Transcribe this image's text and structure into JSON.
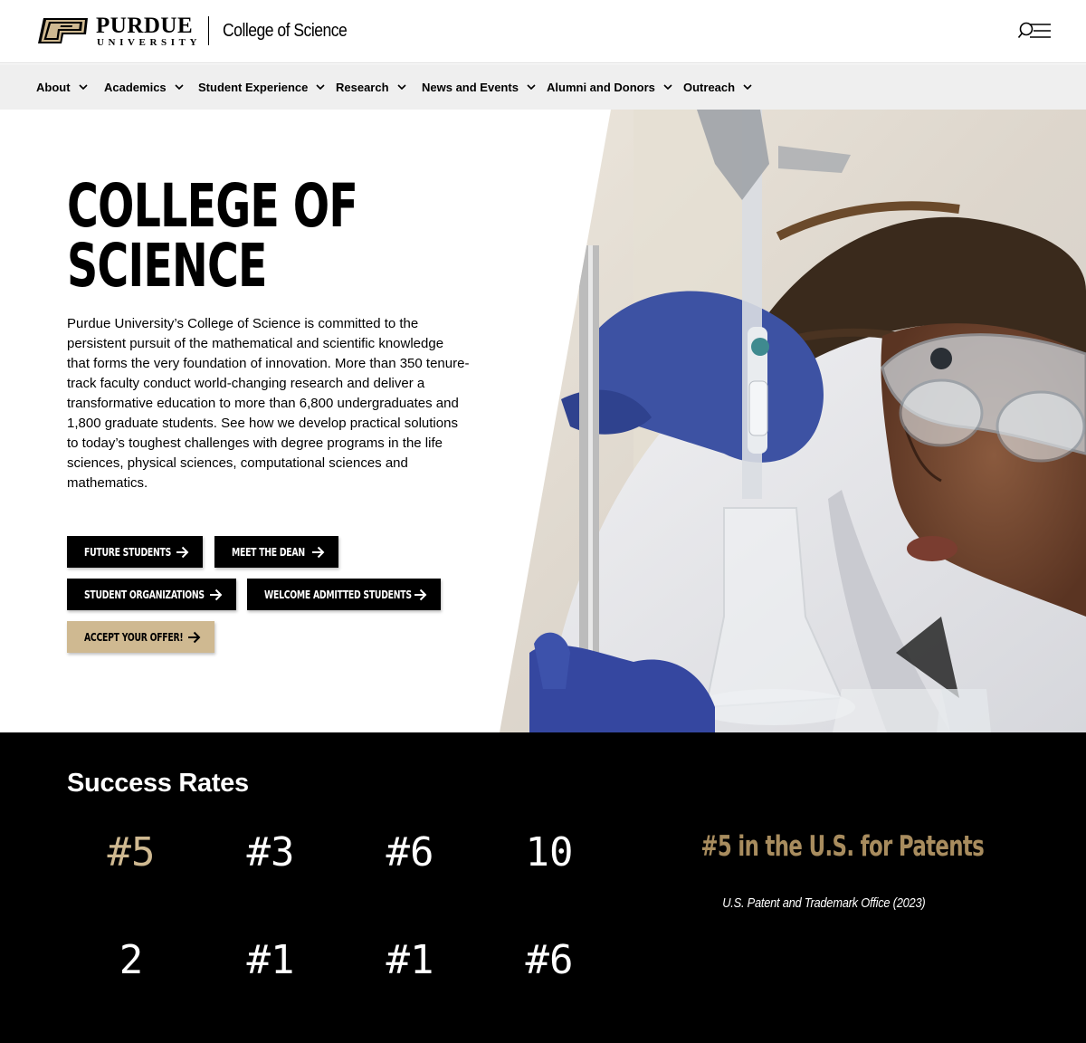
{
  "header": {
    "brand_top": "PURDUE",
    "brand_bottom": "UNIVERSITY",
    "site_name": "College of Science",
    "menu_icon": "search-menu-icon"
  },
  "nav": {
    "items": [
      {
        "label": "About"
      },
      {
        "label": "Academics"
      },
      {
        "label": "Student Experience"
      },
      {
        "label": "Research"
      },
      {
        "label": "News and Events"
      },
      {
        "label": "Alumni and Donors"
      },
      {
        "label": "Outreach"
      }
    ]
  },
  "hero": {
    "title_line1": "COLLEGE OF",
    "title_line2": "SCIENCE",
    "intro": "Purdue University’s College of Science is committed to the persistent pursuit of the mathematical and scientific knowledge that forms the very foundation of innovation. More than 350 tenure-track faculty conduct world-changing research and deliver a transformative education to more than 6,800 undergraduates and 1,800 graduate students. See how we develop practical solutions to today’s toughest challenges with degree programs in the life sciences, physical sciences, computational sciences and mathematics.",
    "buttons": [
      {
        "label": "FUTURE STUDENTS"
      },
      {
        "label": "MEET THE DEAN"
      },
      {
        "label": "STUDENT ORGANIZATIONS"
      },
      {
        "label": "WELCOME ADMITTED STUDENTS"
      },
      {
        "label": "ACCEPT YOUR OFFER!"
      }
    ],
    "photo_subject": "student in lab coat and safety goggles using a pipette"
  },
  "success": {
    "title": "Success Rates",
    "stats": [
      "#5",
      "#3",
      "#6",
      "10",
      "2",
      "#1",
      "#1",
      "#6"
    ],
    "selected_index": 0,
    "feature_title": "#5 in the U.S. for Patents",
    "feature_source": "U.S. Patent and Trademark Office (2023)"
  },
  "colors": {
    "gold": "#cfb991",
    "dark_gold": "#a88c5e",
    "black": "#000000",
    "nav_bg": "#efefef"
  }
}
